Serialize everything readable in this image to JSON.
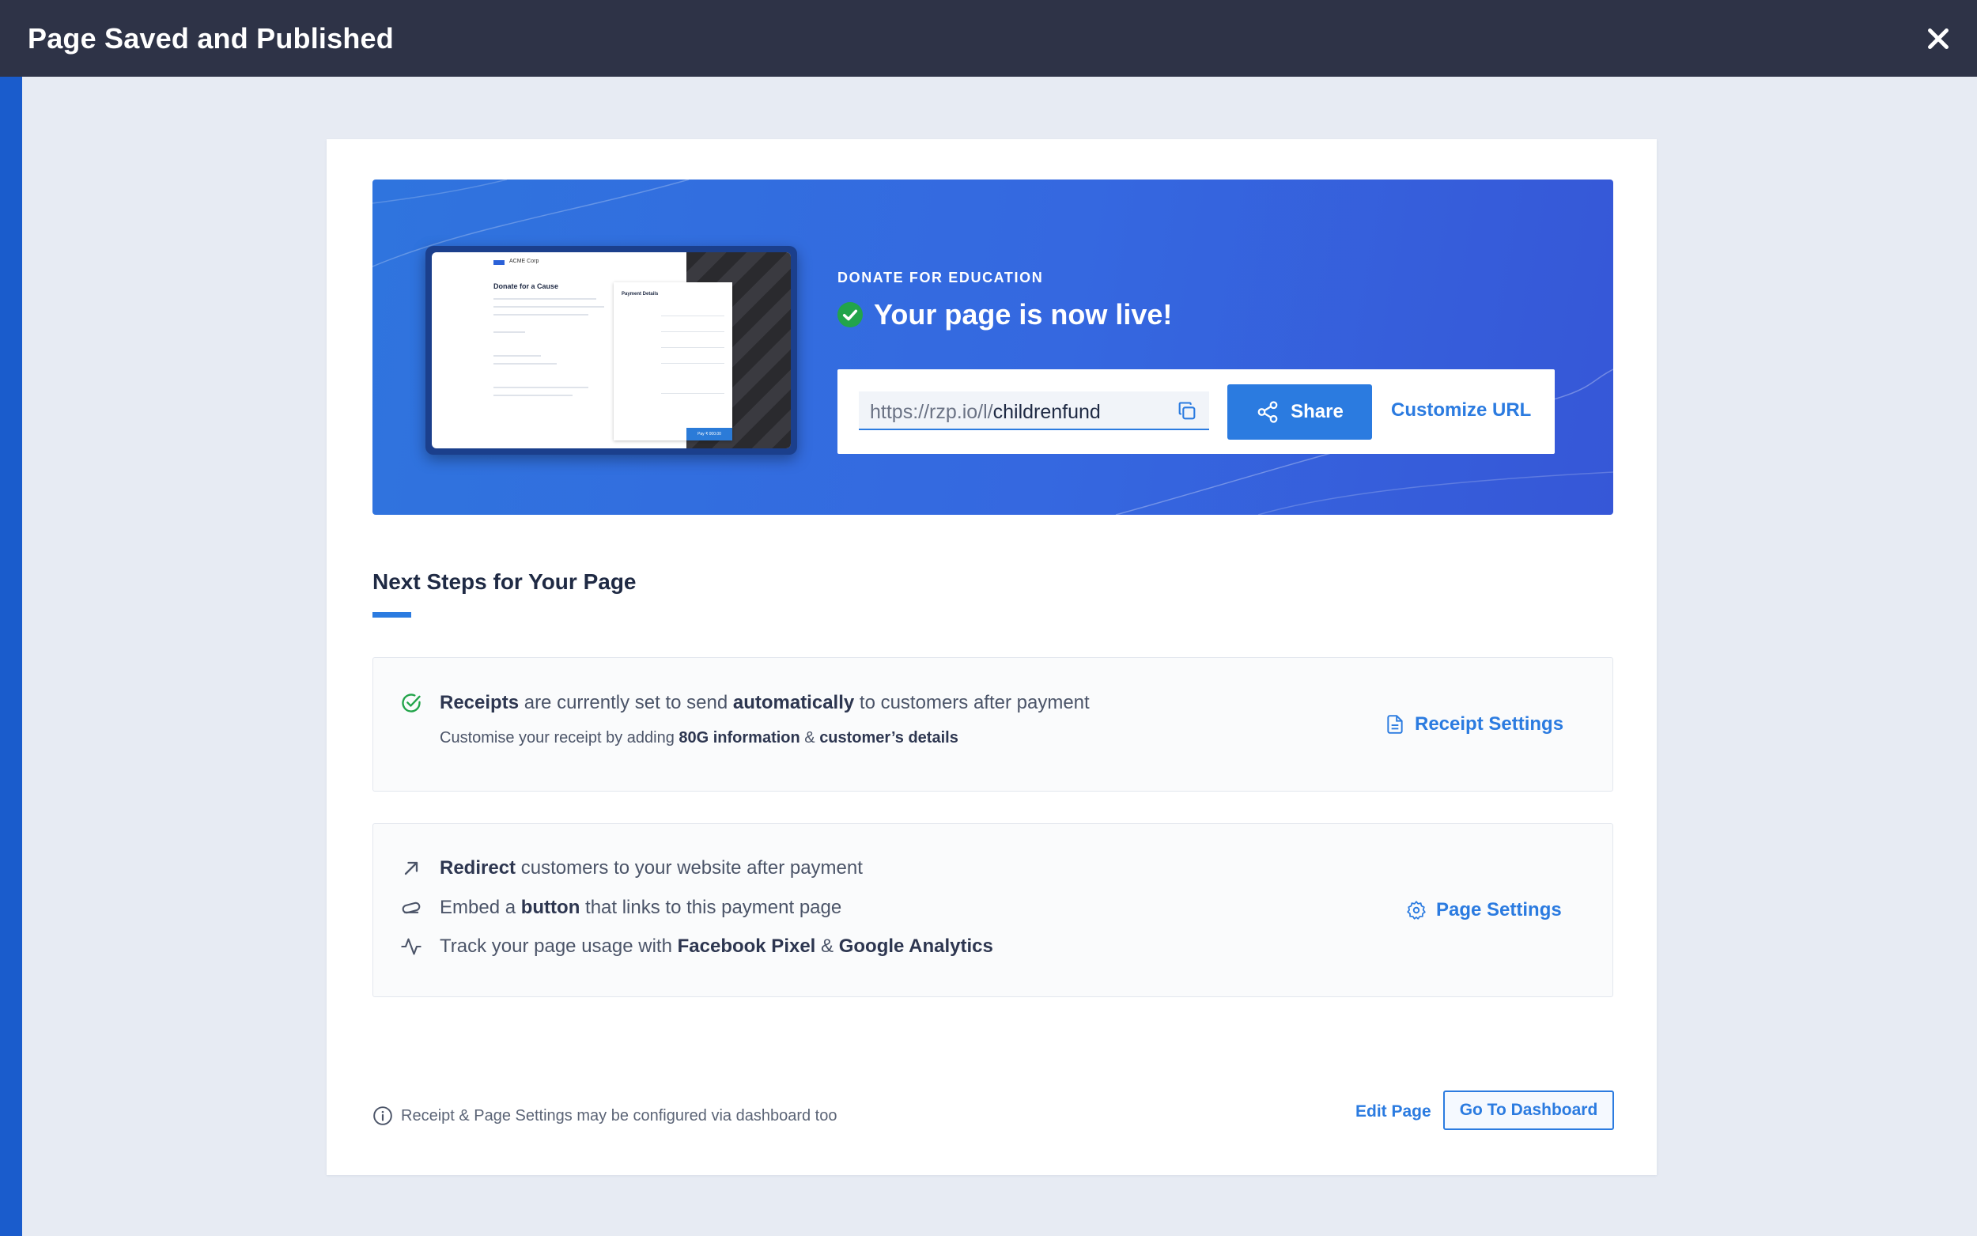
{
  "modal": {
    "title": "Page Saved and Published",
    "close_icon": "close-icon"
  },
  "preview": {
    "company": "ACME Corp",
    "heading": "Donate for a Cause",
    "form_title": "Payment Details",
    "pay_label": "Pay ₹ 000.00"
  },
  "hero": {
    "label": "DONATE FOR EDUCATION",
    "headline": "Your page is now live!",
    "url_base": "https://rzp.io/l/",
    "url_path": "childrenfund",
    "share_label": "Share",
    "customize_label": "Customize URL"
  },
  "next_steps": {
    "title": "Next Steps for Your Page",
    "receipts": {
      "bold1": "Receipts",
      "text1": " are currently set to send ",
      "bold2": "automatically",
      "text2": " to customers after payment",
      "sub_text1": "Customise your receipt by adding ",
      "sub_bold1": "80G information",
      "sub_text2": " & ",
      "sub_bold2": "customer’s details",
      "link": "Receipt Settings"
    },
    "page": {
      "redirect_bold": "Redirect",
      "redirect_text": " customers to your website after payment",
      "embed_text1": "Embed a ",
      "embed_bold": "button",
      "embed_text2": " that links to this payment page",
      "track_text1": "Track your page usage with ",
      "track_bold1": "Facebook Pixel",
      "track_text2": " & ",
      "track_bold2": "Google Analytics",
      "link": "Page Settings"
    }
  },
  "footer": {
    "note": "Receipt & Page Settings may be configured via dashboard too",
    "edit_label": "Edit Page",
    "dashboard_label": "Go To Dashboard"
  },
  "colors": {
    "accent": "#2b7be0",
    "header_bg": "#2e3347",
    "hero_bg": "#3568e0",
    "success": "#22a44a"
  }
}
